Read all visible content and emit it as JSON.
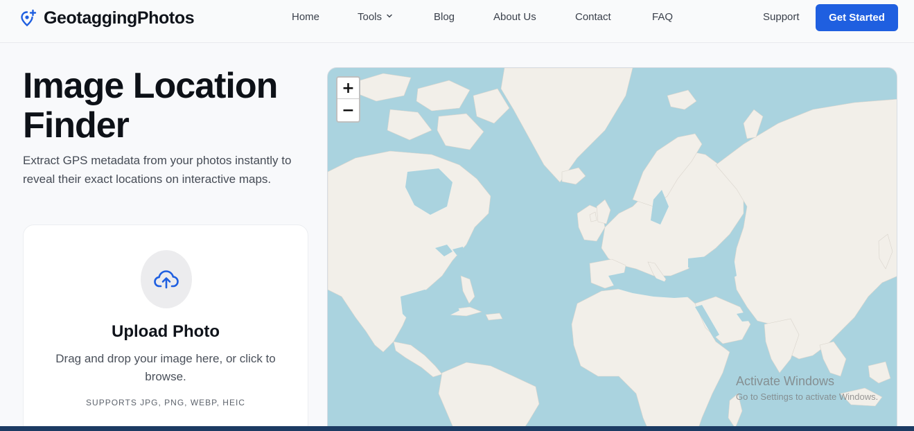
{
  "brand": {
    "name": "GeotaggingPhotos",
    "icon": "map-pin-plus-icon",
    "accent": "#1f5fe0"
  },
  "nav": {
    "items": [
      {
        "label": "Home"
      },
      {
        "label": "Tools",
        "has_dropdown": true
      },
      {
        "label": "Blog"
      },
      {
        "label": "About Us"
      },
      {
        "label": "Contact"
      },
      {
        "label": "FAQ"
      }
    ],
    "support": "Support",
    "cta": "Get Started"
  },
  "hero": {
    "title": "Image Location Finder",
    "subtitle": "Extract GPS metadata from your photos instantly to reveal their exact locations on interactive maps."
  },
  "upload": {
    "icon": "cloud-upload-icon",
    "title": "Upload Photo",
    "description": "Drag and drop your image here, or click to browse.",
    "formats": "SUPPORTS JPG, PNG, WEBP, HEIC"
  },
  "map": {
    "zoom_in": "+",
    "zoom_out": "−",
    "water_color": "#aad3df",
    "land_color": "#f2efe9"
  },
  "watermark": {
    "title": "Activate Windows",
    "subtitle": "Go to Settings to activate Windows."
  }
}
